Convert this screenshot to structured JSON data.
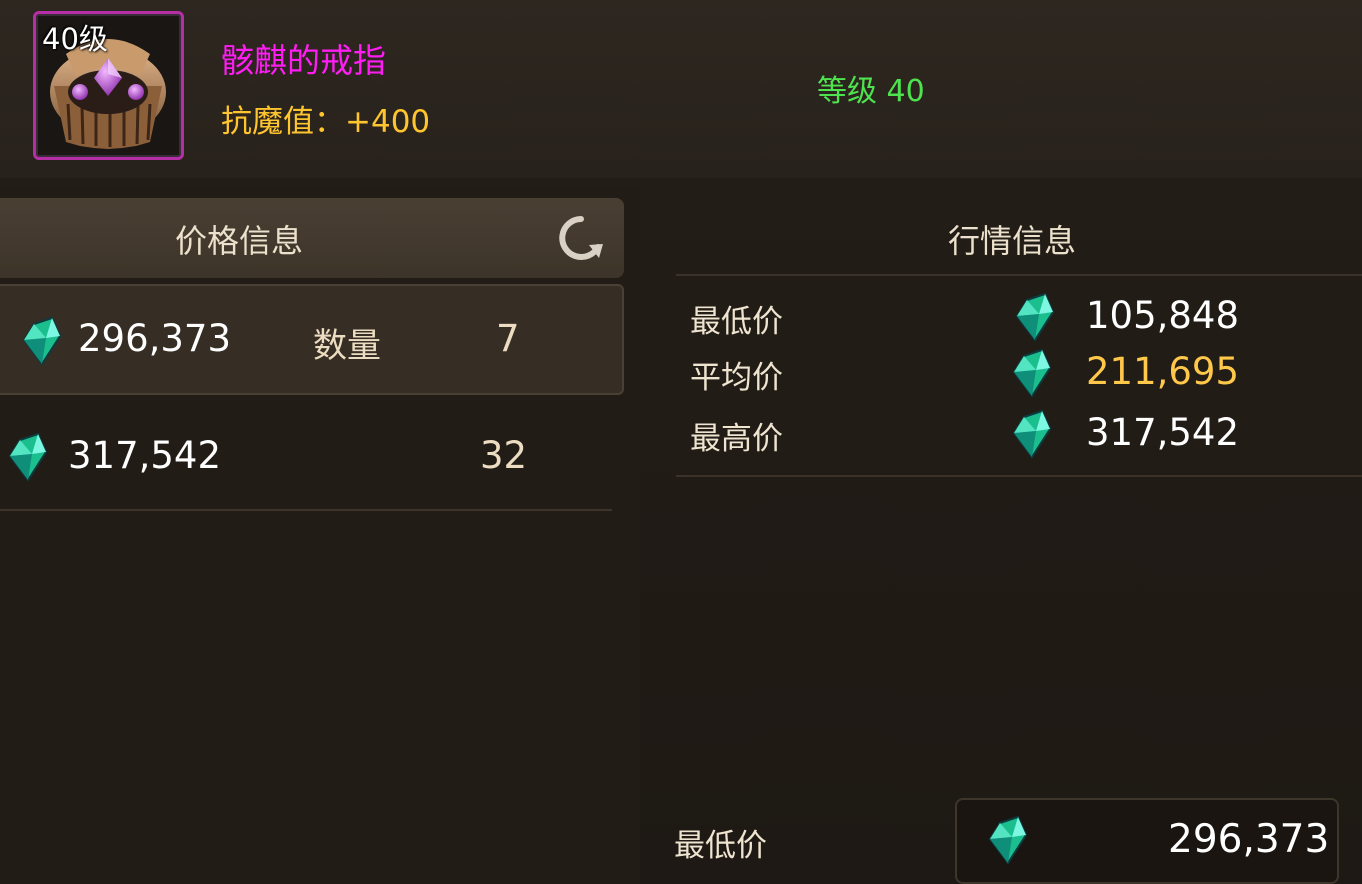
{
  "item": {
    "level_badge": "40级",
    "name": "骸麒的戒指",
    "stat": "抗魔值：+400",
    "requirement": "等级 40",
    "icon": "ring-icon",
    "name_color": "#ff1df4"
  },
  "price_panel": {
    "title": "价格信息",
    "refresh_icon": "refresh-icon",
    "rows": [
      {
        "price": "296,373",
        "qty_label": "数量",
        "qty": "7",
        "selected": true
      },
      {
        "price": "317,542",
        "qty_label": "",
        "qty": "32",
        "selected": false
      }
    ]
  },
  "market_panel": {
    "title": "行情信息",
    "min_label": "最低价",
    "min_value": "105,848",
    "avg_label": "平均价",
    "avg_value": "211,695",
    "max_label": "最高价",
    "max_value": "317,542",
    "avg_color": "#ffc84a"
  },
  "footer": {
    "label": "最低价",
    "value": "296,373"
  },
  "currency_icon": "diamond-gem-icon"
}
